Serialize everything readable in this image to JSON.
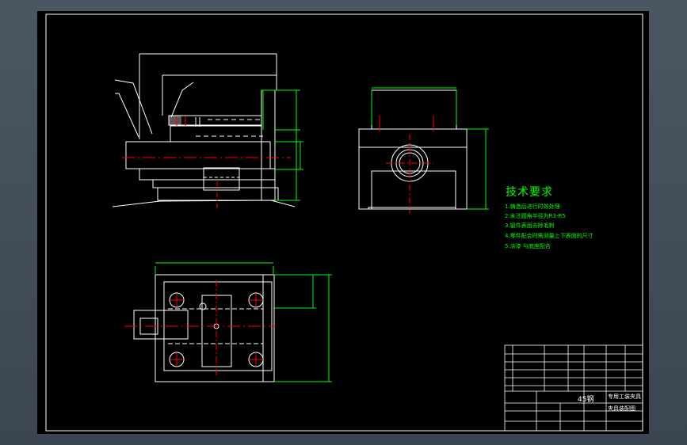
{
  "colors": {
    "background": "#3f4a55",
    "canvas": "#000000",
    "outline": "#ffffff",
    "green": "#00ff00",
    "red": "#ff0000"
  },
  "technical_requirements": {
    "title": "技术要求",
    "items": [
      "1.铸造后进行时效处理",
      "2.未注圆角半径为R3-R5",
      "3.锻件表面去除毛刺",
      "4.零件配合时需测量上下表面的尺寸",
      "5.涂漆 与底座配合"
    ]
  },
  "title_block": {
    "material": "45钢",
    "drawing_name": "夹具装配图",
    "part_title": "专用工装夹具"
  }
}
